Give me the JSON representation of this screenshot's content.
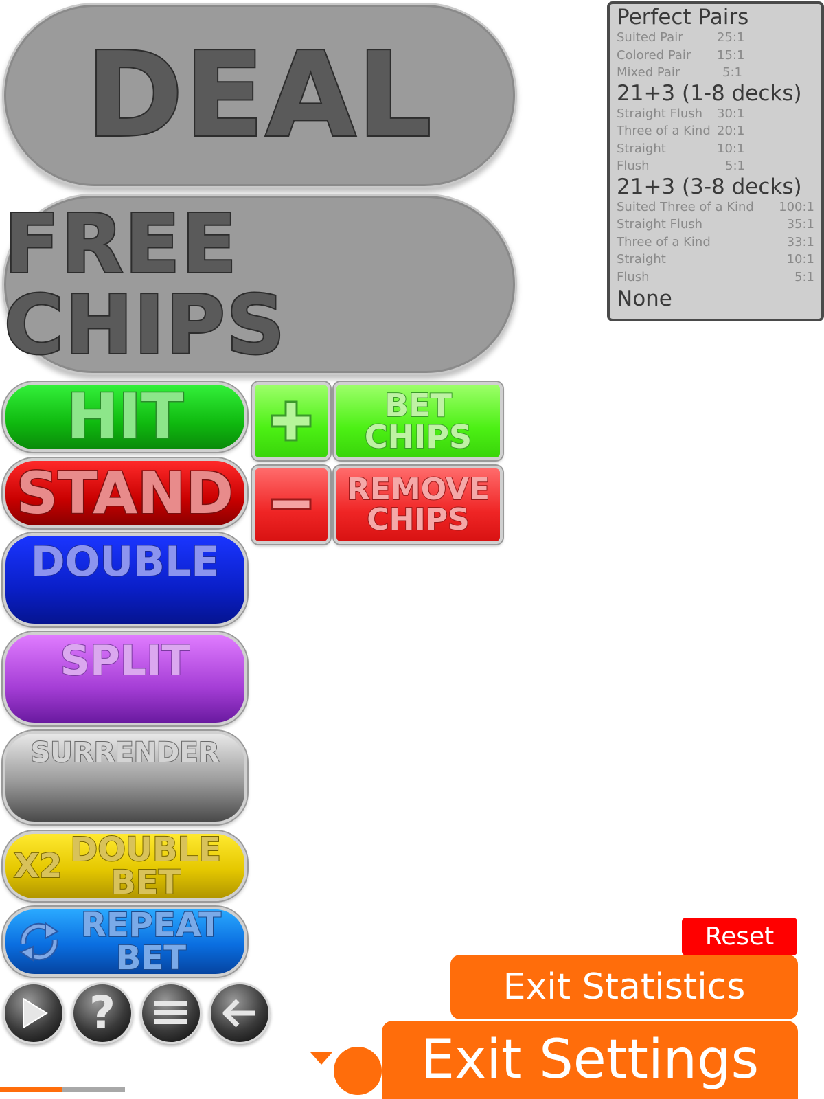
{
  "main_buttons": {
    "deal": "DEAL",
    "free_chips": "FREE CHIPS"
  },
  "actions": {
    "hit": "HIT",
    "stand": "STAND",
    "double": "DOUBLE",
    "split": "SPLIT",
    "surrender": "SURRENDER",
    "double_bet_prefix": "X2",
    "double_bet_line1": "DOUBLE",
    "double_bet_line2": "BET",
    "repeat_bet_line1": "REPEAT",
    "repeat_bet_line2": "BET"
  },
  "chips": {
    "add_symbol": "+",
    "bet_line1": "BET",
    "bet_line2": "CHIPS",
    "remove_symbol": "−",
    "remove_line1": "REMOVE",
    "remove_line2": "CHIPS"
  },
  "round_buttons": [
    {
      "icon": "play-icon"
    },
    {
      "icon": "help-icon",
      "glyph": "?"
    },
    {
      "icon": "menu-icon"
    },
    {
      "icon": "back-arrow-icon"
    }
  ],
  "payouts": {
    "perfect_pairs": {
      "title": "Perfect Pairs",
      "rows": [
        {
          "name": "Suited Pair",
          "value": "25:1"
        },
        {
          "name": "Colored Pair",
          "value": "15:1"
        },
        {
          "name": "Mixed Pair",
          "value": "5:1"
        }
      ]
    },
    "twentyone_plus3_a": {
      "title": "21+3 (1-8 decks)",
      "rows": [
        {
          "name": "Straight Flush",
          "value": "30:1"
        },
        {
          "name": "Three of a Kind",
          "value": "20:1"
        },
        {
          "name": "Straight",
          "value": "10:1"
        },
        {
          "name": "Flush",
          "value": "5:1"
        }
      ]
    },
    "twentyone_plus3_b": {
      "title": "21+3 (3-8 decks)",
      "rows": [
        {
          "name": "Suited Three of a Kind",
          "value": "100:1"
        },
        {
          "name": "Straight Flush",
          "value": "35:1"
        },
        {
          "name": "Three of a Kind",
          "value": "33:1"
        },
        {
          "name": "Straight",
          "value": "10:1"
        },
        {
          "name": "Flush",
          "value": "5:1"
        }
      ]
    },
    "none": "None"
  },
  "footer": {
    "reset": "Reset",
    "exit_statistics": "Exit Statistics",
    "exit_settings": "Exit Settings"
  },
  "colors": {
    "orange": "#ff6d0b",
    "reset_red": "#ff0000",
    "progress_active": "#ff6d0b",
    "progress_track": "#a8a8a8"
  },
  "progress": {
    "fill_fraction": 0.5
  }
}
